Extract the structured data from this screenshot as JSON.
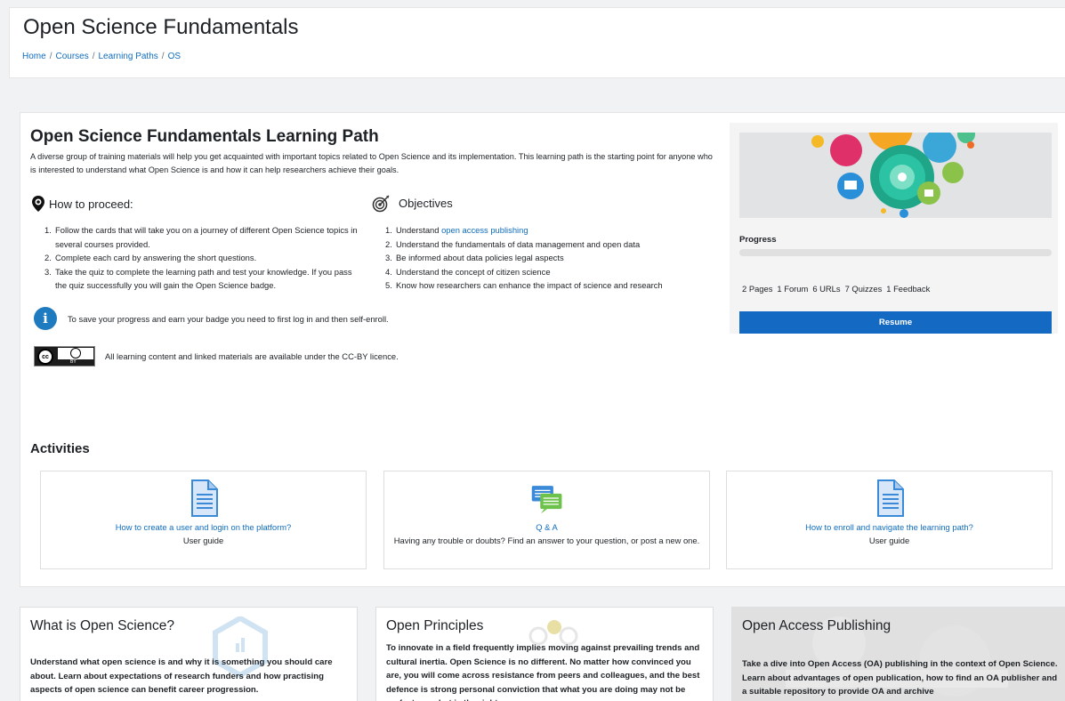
{
  "header": {
    "title": "Open Science Fundamentals",
    "breadcrumb": [
      "Home",
      "Courses",
      "Learning Paths",
      "OS"
    ]
  },
  "learning_path": {
    "title": "Open Science Fundamentals Learning Path",
    "description": "A diverse group of training materials will help you get acquainted with important topics related to Open Science and its implementation. This learning path is the starting point for anyone who is interested to understand what Open Science is and how it can help researchers achieve their goals.",
    "how_to": {
      "heading": "How to proceed:",
      "items": [
        {
          "num": "1.",
          "text": "Follow the cards that will take you on a journey of different Open Science topics in several courses provided."
        },
        {
          "num": "2.",
          "text": "Complete each card by answering the short questions."
        },
        {
          "num": "3.",
          "text": "Take the quiz to complete the learning path and test your knowledge. If you pass the quiz successfully you will gain the Open Science badge."
        }
      ]
    },
    "objectives": {
      "heading": "Objectives",
      "item1_prefix": "Understand ",
      "item1_link": "open access publishing",
      "items": [
        {
          "num": "2.",
          "text": "Understand the fundamentals of data management and open data"
        },
        {
          "num": "3.",
          "text": "Be informed about data policies legal aspects"
        },
        {
          "num": "4.",
          "text": "Understand the concept of citizen science"
        },
        {
          "num": "5.",
          "text": "Know how researchers can enhance the impact of science and research"
        }
      ]
    },
    "info_text": "To save your progress and earn your badge you need to first log in and then self-enroll.",
    "licence_text": "All learning content and linked materials are available under the CC-BY licence.",
    "cc_badge": {
      "cc": "cc",
      "by": "BY"
    }
  },
  "side_panel": {
    "progress_label": "Progress",
    "progress_value": 0,
    "counts": [
      "2 Pages",
      "1 Forum",
      "6 URLs",
      "7 Quizzes",
      "1 Feedback"
    ],
    "resume_label": "Resume"
  },
  "activities": {
    "heading": "Activities",
    "cards": [
      {
        "link": "How to create a user and login on the platform?",
        "subtitle": "User guide",
        "icon": "page-icon"
      },
      {
        "link": "Q & A",
        "subtitle": "Having any trouble or doubts? Find an answer to your question, or post a new one.",
        "icon": "forum-icon"
      },
      {
        "link": "How to enroll and navigate the learning path?",
        "subtitle": "User guide",
        "icon": "page-icon"
      }
    ]
  },
  "courses": [
    {
      "title": "What is Open Science?",
      "text": "Understand what open science is and why it is something you should care about. Learn about expectations of research funders and how practising aspects of open science can benefit career progression."
    },
    {
      "title": "Open Principles",
      "text": "To innovate in a field frequently implies moving against prevailing trends and cultural inertia. Open Science is no different. No matter how convinced you are, you will come across resistance from peers and colleagues, and the best defence is strong personal conviction that what you are doing may not be perfect now, but is the right"
    },
    {
      "title": "Open Access Publishing",
      "text": "Take a dive into Open Access (OA) publishing in the context of Open Science. Learn about advantages of open publication, how to find an OA publisher and a suitable repository to provide OA and archive"
    }
  ],
  "colors": {
    "link": "#0f6cbf",
    "resume": "#1469c3",
    "info": "#1f7bbf"
  }
}
